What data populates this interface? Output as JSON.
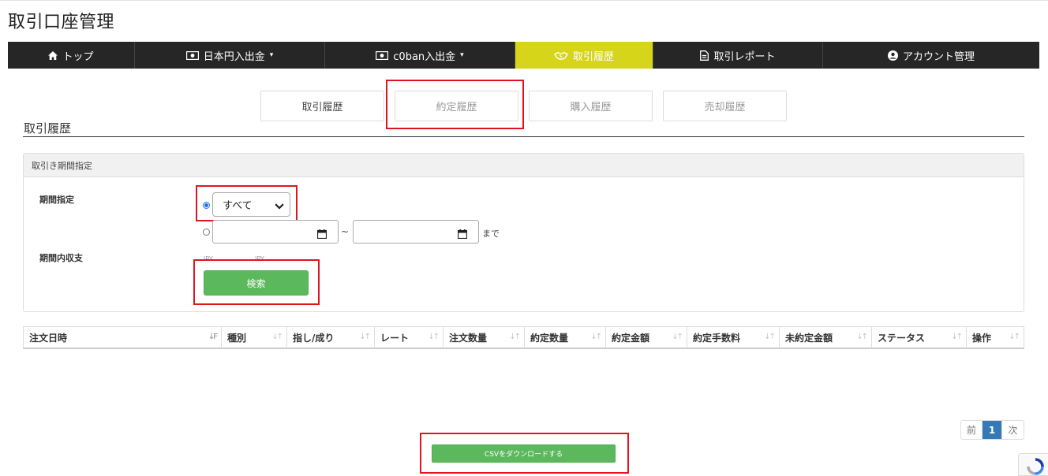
{
  "page": {
    "title": "取引口座管理"
  },
  "nav": {
    "items": [
      {
        "label": "トップ",
        "icon": "home-icon"
      },
      {
        "label": "日本円入出金",
        "icon": "money-icon",
        "dropdown": true
      },
      {
        "label": "c0ban入出金",
        "icon": "money-icon",
        "dropdown": true
      },
      {
        "label": "取引履歴",
        "icon": "handshake-icon",
        "active": true
      },
      {
        "label": "取引レポート",
        "icon": "document-icon"
      },
      {
        "label": "アカウント管理",
        "icon": "user-circle-icon"
      }
    ],
    "active_color": "#d6d51a",
    "bar_color": "#262626"
  },
  "subtabs": [
    {
      "label": "取引履歴"
    },
    {
      "label": "約定履歴"
    },
    {
      "label": "購入履歴"
    },
    {
      "label": "売却履歴"
    }
  ],
  "section": {
    "title": "取引履歴"
  },
  "filter": {
    "panel_title": "取引き期間指定",
    "period_label": "期間指定",
    "select_value": "すべて",
    "range_suffix": "まで",
    "range_separator": "~",
    "balance_label": "期間内収支",
    "balance_units": [
      "JPY",
      "JPY"
    ],
    "search_button": "検索"
  },
  "table": {
    "columns": [
      "注文日時",
      "種別",
      "指し/成り",
      "レート",
      "注文数量",
      "約定数量",
      "約定金額",
      "約定手数料",
      "未約定金額",
      "ステータス",
      "操作"
    ]
  },
  "pagination": {
    "prev": "前",
    "current": "1",
    "next": "次"
  },
  "csv_button": "CSVをダウンロードする",
  "colors": {
    "green": "#5cb85c",
    "highlight_red": "#e0141e",
    "page_blue": "#337ab7"
  }
}
